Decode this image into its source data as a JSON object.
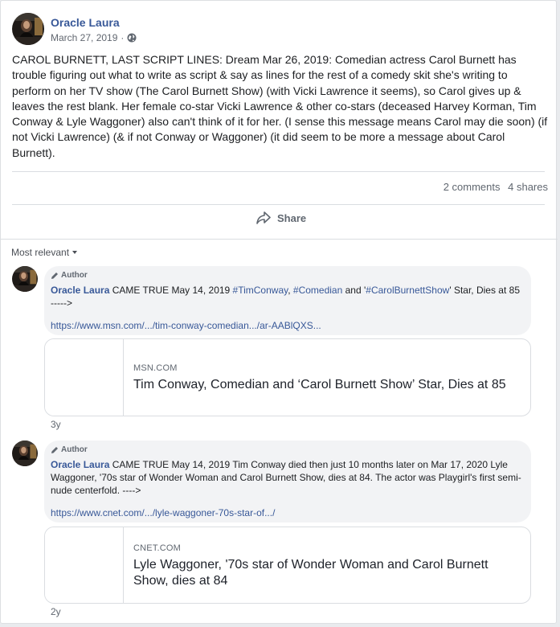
{
  "post": {
    "author": "Oracle Laura",
    "date": "March 27, 2019",
    "separator": "·",
    "privacy_icon": "globe-icon",
    "body": "CAROL BURNETT, LAST SCRIPT LINES: Dream Mar 26, 2019: Comedian actress Carol Burnett has trouble figuring out what to write as script & say as lines for the rest of a comedy skit she's writing to perform on her TV show (The Carol Burnett Show) (with Vicki Lawrence it seems), so Carol gives up & leaves the rest blank. Her female co-star Vicki Lawrence & other co-stars (deceased Harvey Korman, Tim Conway & Lyle Waggoner) also can't think of it for her. (I sense this message means Carol may die soon) (if not Vicki Lawrence) (& if not Conway or Waggoner) (it did seem to be more a message about Carol Burnett).",
    "comments_count": "2 comments",
    "shares_count": "4 shares",
    "share_label": "Share"
  },
  "comments_section": {
    "sort_label": "Most relevant"
  },
  "comments": [
    {
      "badge": "Author",
      "author": "Oracle Laura",
      "text_a": " CAME TRUE May 14, 2019 ",
      "tag1": "#TimConway",
      "text_b": ", ",
      "tag2": "#Comedian",
      "text_c": " and '",
      "tag3": "#CarolBurnettShow",
      "text_d": "' Star, Dies at 85 ----->",
      "url": "https://www.msn.com/.../tim-conway-comedian.../ar-AABlQXS...",
      "preview_domain": "MSN.COM",
      "preview_title": "Tim Conway, Comedian and ‘Carol Burnett Show’ Star, Dies at 85",
      "time": "3y"
    },
    {
      "badge": "Author",
      "author": "Oracle Laura",
      "text": " CAME TRUE May 14, 2019 Tim Conway died then just 10 months later on Mar 17, 2020 Lyle Waggoner, '70s star of Wonder Woman and Carol Burnett Show, dies at 84. The actor was Playgirl's first semi-nude centerfold. ---->",
      "url": "https://www.cnet.com/.../lyle-waggoner-70s-star-of.../",
      "preview_domain": "CNET.COM",
      "preview_title": "Lyle Waggoner, '70s star of Wonder Woman and Carol Burnett Show, dies at 84",
      "time": "2y"
    }
  ],
  "colors": {
    "link": "#385898",
    "bubble": "#f2f3f5",
    "background": "#e9ebee"
  }
}
